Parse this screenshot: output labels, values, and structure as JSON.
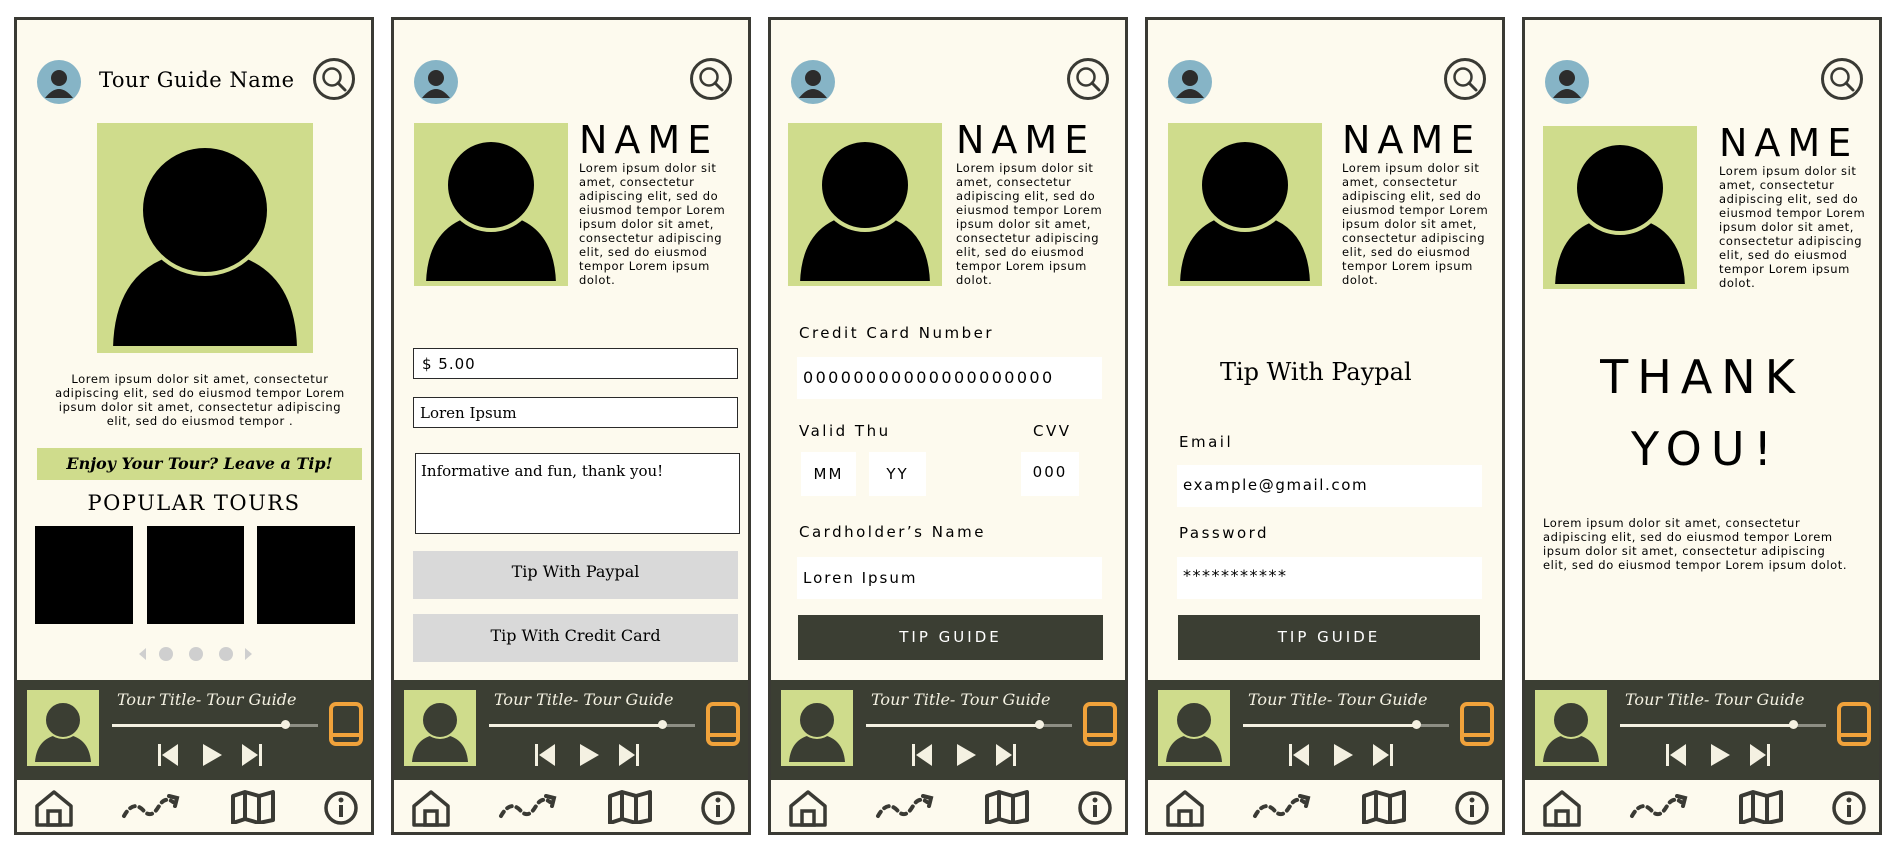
{
  "colors": {
    "accent_green": "#cfdc8c",
    "dark": "#3b3e33",
    "background": "#fdfaee",
    "book_orange": "#f0a23b",
    "avatar_blue": "#86b4c6"
  },
  "common": {
    "name_heading": "NAME",
    "bio": "Lorem ipsum dolor sit amet, consectetur adipiscing elit, sed do eiusmod tempor Lorem ipsum dolor sit amet, consectetur adipiscing elit, sed do eiusmod tempor Lorem ipsum dolot.",
    "player": {
      "title": "Tour Title- Tour Guide",
      "progress": 0.84
    },
    "nav": [
      "home-icon",
      "route-icon",
      "map-icon",
      "info-icon"
    ],
    "icons": {
      "search": "search-icon",
      "avatar": "user-avatar-icon",
      "book": "book-icon"
    }
  },
  "screen1": {
    "title": "Tour Guide Name",
    "bio": "Lorem ipsum dolor sit amet, consectetur adipiscing elit, sed do eiusmod tempor Lorem ipsum dolor sit amet, consectetur adipiscing elit, sed do eiusmod tempor .",
    "tip_banner": "Enjoy Your Tour? Leave a Tip!",
    "popular_heading": "POPULAR TOURS",
    "carousel_dots": 3
  },
  "screen2": {
    "amount": "$ 5.00",
    "name_value": "Loren Ipsum",
    "message": "Informative and fun, thank you!",
    "paypal_button": "Tip With Paypal",
    "card_button": "Tip With Credit Card"
  },
  "screen3": {
    "card_label": "Credit Card Number",
    "card_value": "00000000000000000000",
    "valid_label": "Valid Thu",
    "mm": "MM",
    "yy": "YY",
    "cvv_label": "CVV",
    "cvv_value": "000",
    "holder_label": "Cardholder’s Name",
    "holder_value": "Loren Ipsum",
    "submit": "TIP GUIDE"
  },
  "screen4": {
    "heading": "Tip With Paypal",
    "email_label": "Email",
    "email_value": "example@gmail.com",
    "password_label": "Password",
    "password_value": "***********",
    "submit": "TIP GUIDE"
  },
  "screen5": {
    "thank_1": "THANK",
    "thank_2": "YOU!",
    "text": "Lorem ipsum dolor sit amet, consectetur adipiscing elit, sed do eiusmod tempor Lorem ipsum dolor sit amet, consectetur adipiscing elit, sed do eiusmod tempor Lorem ipsum dolot."
  }
}
